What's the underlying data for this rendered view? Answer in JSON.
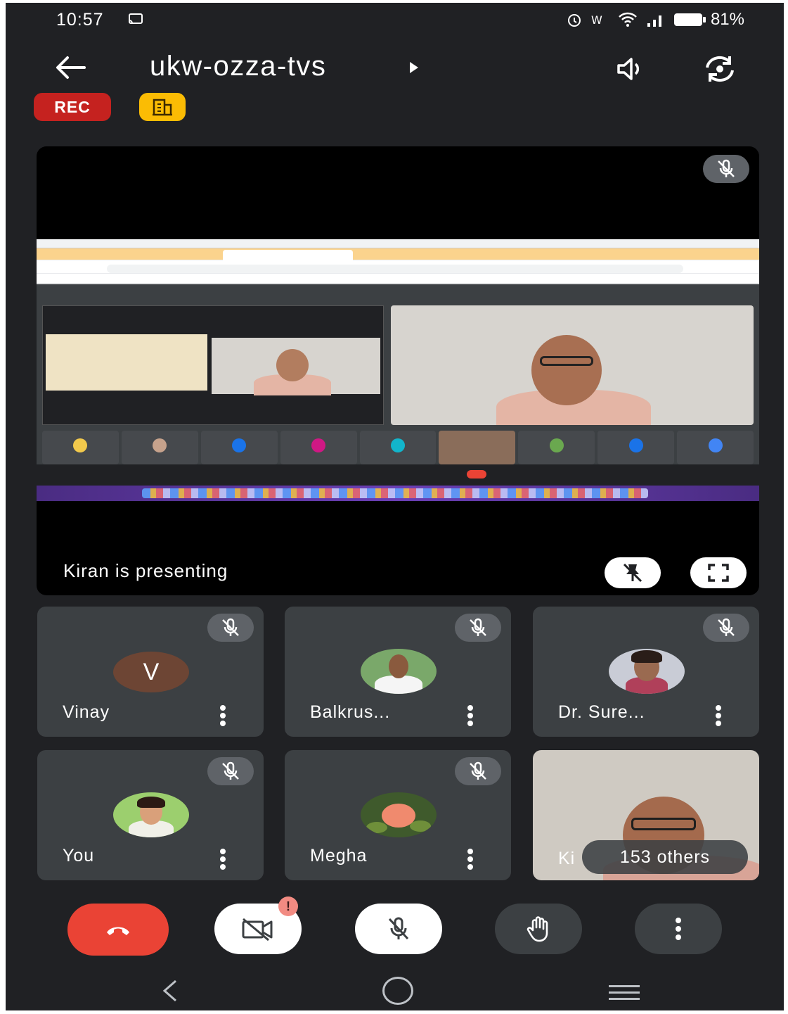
{
  "status_bar": {
    "time": "10:57",
    "battery": "81%",
    "icons": [
      "cast-icon",
      "alarm-icon",
      "volte-icon",
      "wifi-icon",
      "signal-icon",
      "battery-icon"
    ]
  },
  "header": {
    "meeting_code": "ukw-ozza-tvs",
    "icons": [
      "back-arrow-icon",
      "speaker-icon",
      "switch-camera-icon"
    ]
  },
  "badges": {
    "recording": "REC",
    "companion_icon": "building-icon"
  },
  "presentation": {
    "label": "Kiran is presenting",
    "icons": [
      "mic-off-icon",
      "unpin-icon",
      "fullscreen-icon"
    ]
  },
  "participants": [
    {
      "name": "Vinay",
      "avatar_type": "letter",
      "avatar_letter": "V",
      "avatar_color": "#6d4534",
      "muted": true
    },
    {
      "name": "Balkrus...",
      "avatar_type": "photo",
      "muted": true
    },
    {
      "name": "Dr. Sure...",
      "avatar_type": "photo",
      "muted": true
    },
    {
      "name": "You",
      "avatar_type": "photo",
      "muted": true
    },
    {
      "name": "Megha",
      "avatar_type": "photo",
      "muted": true
    },
    {
      "name": "Ki",
      "avatar_type": "video",
      "others_label": "153 others"
    }
  ],
  "controls": {
    "alert_badge": "!",
    "icons": [
      "end-call-icon",
      "camera-off-icon",
      "mic-off-icon",
      "raise-hand-icon",
      "more-options-icon"
    ],
    "colors": {
      "end_call": "#ea4335",
      "active": "#ffffff",
      "inactive": "#3c4043"
    }
  },
  "nav_bar": {
    "icons": [
      "nav-back-icon",
      "nav-home-icon",
      "nav-recents-icon"
    ]
  },
  "colors": {
    "background": "#202124",
    "tile": "#3c4043",
    "rec": "#c5221f",
    "companion": "#fbbc04"
  }
}
